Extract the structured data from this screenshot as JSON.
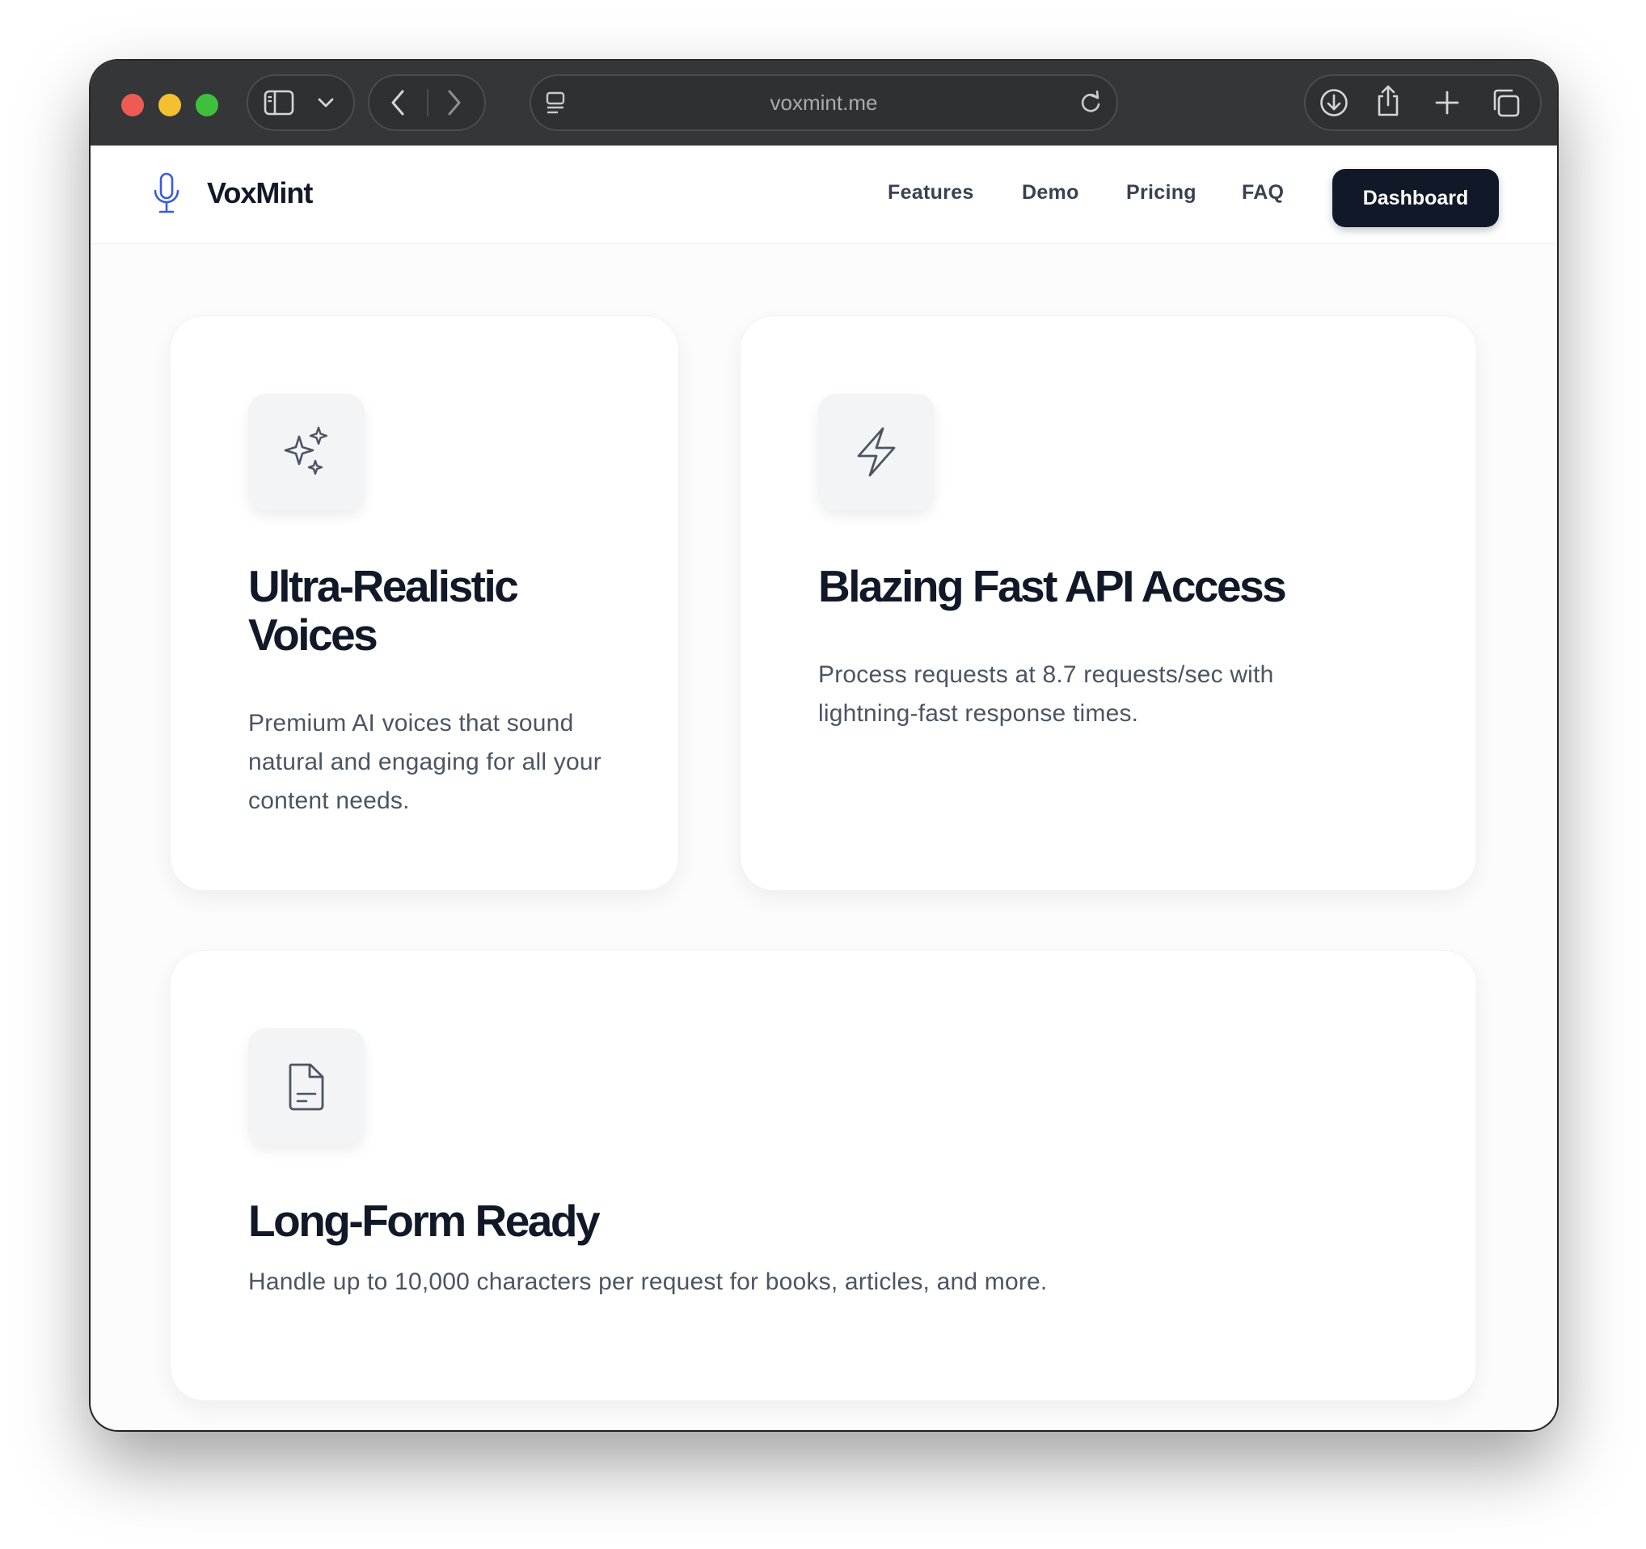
{
  "browser": {
    "url": "voxmint.me",
    "icons": [
      "sidebar-icon",
      "chevron-down-icon",
      "back-icon",
      "forward-icon",
      "reader-icon",
      "reload-icon",
      "download-icon",
      "share-icon",
      "new-tab-icon",
      "tabs-overview-icon"
    ]
  },
  "site": {
    "brand": "VoxMint",
    "brand_icon": "microphone-icon",
    "nav": [
      "Features",
      "Demo",
      "Pricing",
      "FAQ"
    ],
    "cta": "Dashboard"
  },
  "features": [
    {
      "icon": "sparkles-icon",
      "title": "Ultra-Realistic Voices",
      "description": "Premium AI voices that sound natural and engaging for all your content needs."
    },
    {
      "icon": "lightning-icon",
      "title": "Blazing Fast API Access",
      "description": "Process requests at 8.7 requests/sec with lightning-fast response times."
    },
    {
      "icon": "document-icon",
      "title": "Long-Form Ready",
      "description": "Handle up to 10,000 characters per request for books, articles, and more."
    }
  ],
  "colors": {
    "accent_blue": "#3b5bdb",
    "button_dark": "#111827",
    "traffic_red": "#ee5b54",
    "traffic_yellow": "#f5c02f",
    "traffic_green": "#3fc03c"
  }
}
